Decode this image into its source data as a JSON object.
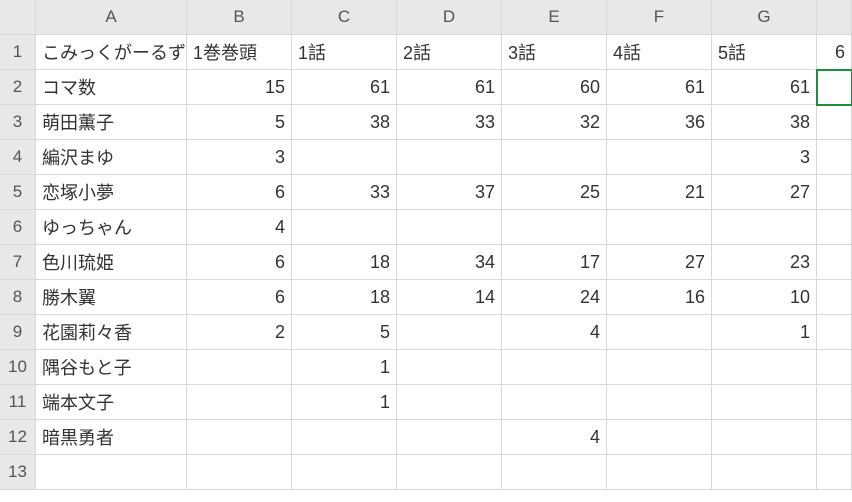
{
  "columns": [
    "A",
    "B",
    "C",
    "D",
    "E",
    "F",
    "G"
  ],
  "rowCount": 13,
  "selectedCell": "H2",
  "peekH1": "6",
  "data": {
    "A1": "こみっくがーるず",
    "B1": "1巻巻頭",
    "C1": "1話",
    "D1": "2話",
    "E1": "3話",
    "F1": "4話",
    "G1": "5話",
    "A2": "コマ数",
    "B2": "15",
    "C2": "61",
    "D2": "61",
    "E2": "60",
    "F2": "61",
    "G2": "61",
    "A3": "萌田薫子",
    "B3": "5",
    "C3": "38",
    "D3": "33",
    "E3": "32",
    "F3": "36",
    "G3": "38",
    "A4": "編沢まゆ",
    "B4": "3",
    "G4": "3",
    "A5": "恋塚小夢",
    "B5": "6",
    "C5": "33",
    "D5": "37",
    "E5": "25",
    "F5": "21",
    "G5": "27",
    "A6": "ゆっちゃん",
    "B6": "4",
    "A7": "色川琉姫",
    "B7": "6",
    "C7": "18",
    "D7": "34",
    "E7": "17",
    "F7": "27",
    "G7": "23",
    "A8": "勝木翼",
    "B8": "6",
    "C8": "18",
    "D8": "14",
    "E8": "24",
    "F8": "16",
    "G8": "10",
    "A9": "花園莉々香",
    "B9": "2",
    "C9": "5",
    "E9": "4",
    "G9": "1",
    "A10": "隅谷もと子",
    "C10": "1",
    "A11": "端本文子",
    "C11": "1",
    "A12": "暗黒勇者",
    "E12": "4"
  },
  "chart_data": {
    "type": "table",
    "title": "こみっくがーるず",
    "columns": [
      "1巻巻頭",
      "1話",
      "2話",
      "3話",
      "4話",
      "5話"
    ],
    "rows": [
      {
        "name": "コマ数",
        "values": [
          15,
          61,
          61,
          60,
          61,
          61
        ]
      },
      {
        "name": "萌田薫子",
        "values": [
          5,
          38,
          33,
          32,
          36,
          38
        ]
      },
      {
        "name": "編沢まゆ",
        "values": [
          3,
          null,
          null,
          null,
          null,
          3
        ]
      },
      {
        "name": "恋塚小夢",
        "values": [
          6,
          33,
          37,
          25,
          21,
          27
        ]
      },
      {
        "name": "ゆっちゃん",
        "values": [
          4,
          null,
          null,
          null,
          null,
          null
        ]
      },
      {
        "name": "色川琉姫",
        "values": [
          6,
          18,
          34,
          17,
          27,
          23
        ]
      },
      {
        "name": "勝木翼",
        "values": [
          6,
          18,
          14,
          24,
          16,
          10
        ]
      },
      {
        "name": "花園莉々香",
        "values": [
          2,
          5,
          null,
          4,
          null,
          1
        ]
      },
      {
        "name": "隅谷もと子",
        "values": [
          null,
          1,
          null,
          null,
          null,
          null
        ]
      },
      {
        "name": "端本文子",
        "values": [
          null,
          1,
          null,
          null,
          null,
          null
        ]
      },
      {
        "name": "暗黒勇者",
        "values": [
          null,
          null,
          null,
          4,
          null,
          null
        ]
      }
    ]
  }
}
